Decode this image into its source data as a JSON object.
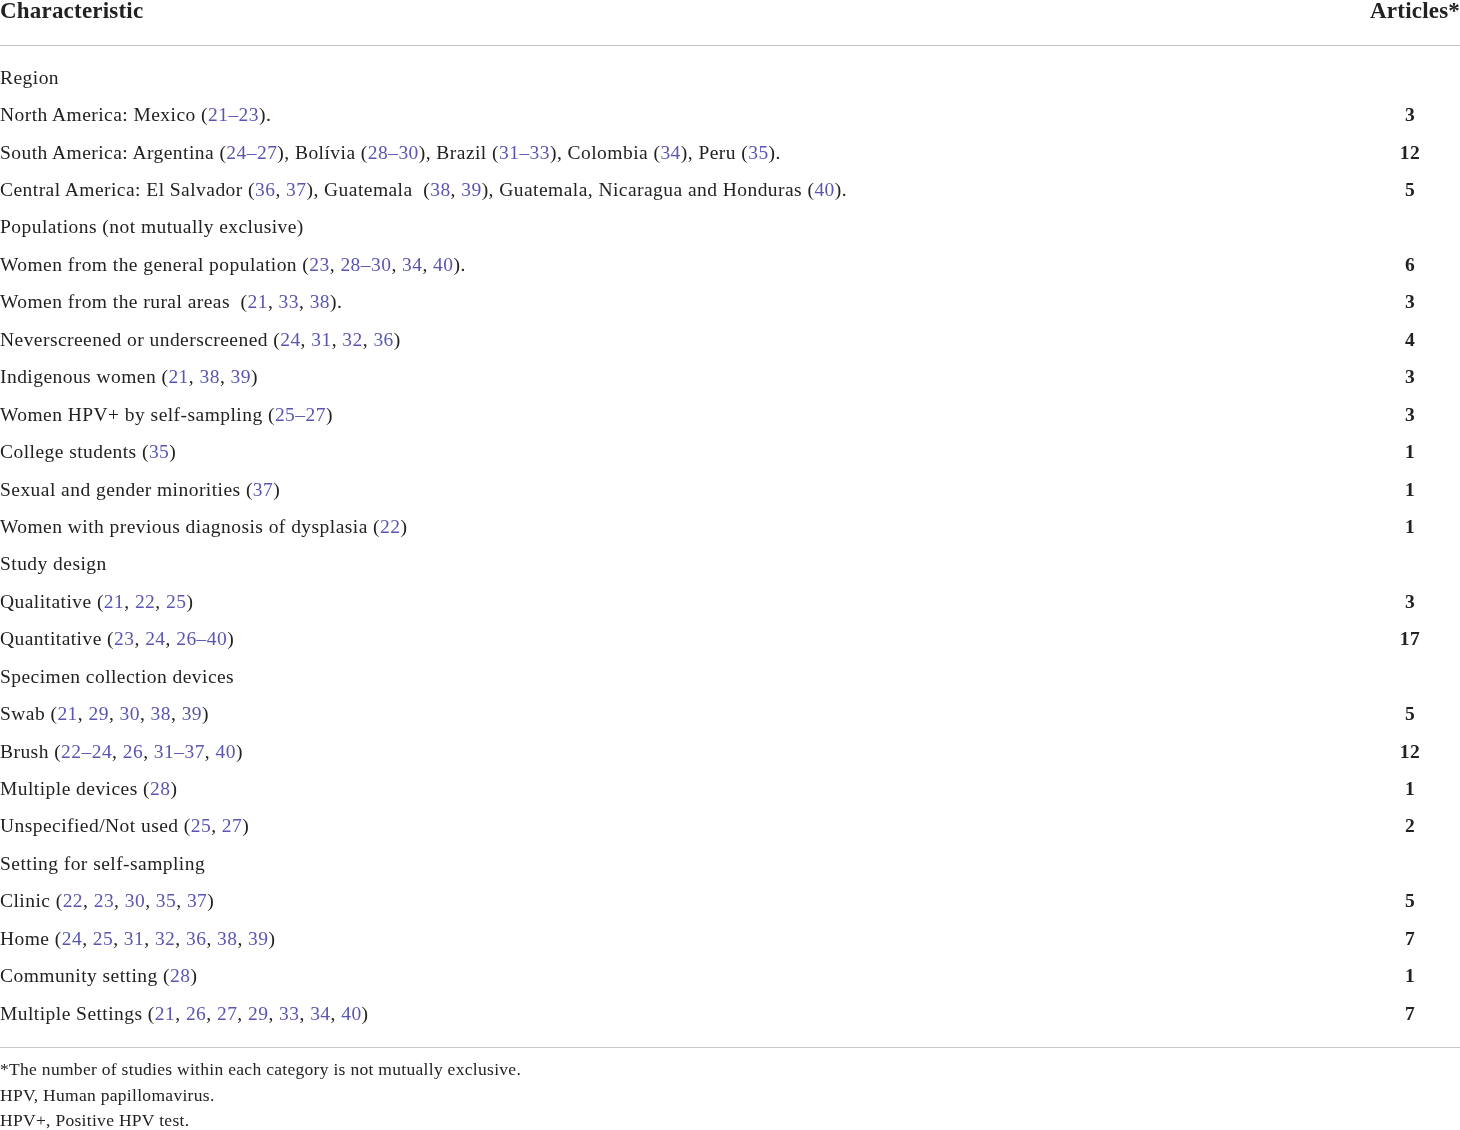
{
  "table": {
    "columns": [
      "Characteristic",
      "Articles*"
    ],
    "rows": [
      {
        "kind": "group",
        "segments": [
          {
            "kind": "text",
            "text": "Region"
          }
        ]
      },
      {
        "kind": "item",
        "count": "3",
        "segments": [
          {
            "kind": "text",
            "text": "North America: Mexico ("
          },
          {
            "kind": "citation",
            "text": "21–23"
          },
          {
            "kind": "text",
            "text": ")."
          }
        ]
      },
      {
        "kind": "item",
        "count": "12",
        "segments": [
          {
            "kind": "text",
            "text": "South America: Argentina ("
          },
          {
            "kind": "citation",
            "text": "24–27"
          },
          {
            "kind": "text",
            "text": "), Bolívia ("
          },
          {
            "kind": "citation",
            "text": "28–30"
          },
          {
            "kind": "text",
            "text": "), Brazil ("
          },
          {
            "kind": "citation",
            "text": "31–33"
          },
          {
            "kind": "text",
            "text": "), Colombia ("
          },
          {
            "kind": "citation",
            "text": "34"
          },
          {
            "kind": "text",
            "text": "), Peru ("
          },
          {
            "kind": "citation",
            "text": "35"
          },
          {
            "kind": "text",
            "text": ")."
          }
        ]
      },
      {
        "kind": "item",
        "count": "5",
        "segments": [
          {
            "kind": "text",
            "text": "Central America: El Salvador ("
          },
          {
            "kind": "citation",
            "text": "36"
          },
          {
            "kind": "text",
            "text": ", "
          },
          {
            "kind": "citation",
            "text": "37"
          },
          {
            "kind": "text",
            "text": "), Guatemala  ("
          },
          {
            "kind": "citation",
            "text": "38"
          },
          {
            "kind": "text",
            "text": ", "
          },
          {
            "kind": "citation",
            "text": "39"
          },
          {
            "kind": "text",
            "text": "), Guatemala, Nicaragua and Honduras ("
          },
          {
            "kind": "citation",
            "text": "40"
          },
          {
            "kind": "text",
            "text": ")."
          }
        ]
      },
      {
        "kind": "group",
        "segments": [
          {
            "kind": "text",
            "text": "Populations (not mutually exclusive)"
          }
        ]
      },
      {
        "kind": "item",
        "count": "6",
        "segments": [
          {
            "kind": "text",
            "text": "Women from the general population ("
          },
          {
            "kind": "citation",
            "text": "23"
          },
          {
            "kind": "text",
            "text": ", "
          },
          {
            "kind": "citation",
            "text": "28–30"
          },
          {
            "kind": "text",
            "text": ", "
          },
          {
            "kind": "citation",
            "text": "34"
          },
          {
            "kind": "text",
            "text": ", "
          },
          {
            "kind": "citation",
            "text": "40"
          },
          {
            "kind": "text",
            "text": ")."
          }
        ]
      },
      {
        "kind": "item",
        "count": "3",
        "segments": [
          {
            "kind": "text",
            "text": "Women from the rural areas  ("
          },
          {
            "kind": "citation",
            "text": "21"
          },
          {
            "kind": "text",
            "text": ", "
          },
          {
            "kind": "citation",
            "text": "33"
          },
          {
            "kind": "text",
            "text": ", "
          },
          {
            "kind": "citation",
            "text": "38"
          },
          {
            "kind": "text",
            "text": ")."
          }
        ]
      },
      {
        "kind": "item",
        "count": "4",
        "segments": [
          {
            "kind": "text",
            "text": "Neverscreened or underscreened ("
          },
          {
            "kind": "citation",
            "text": "24"
          },
          {
            "kind": "text",
            "text": ", "
          },
          {
            "kind": "citation",
            "text": "31"
          },
          {
            "kind": "text",
            "text": ", "
          },
          {
            "kind": "citation",
            "text": "32"
          },
          {
            "kind": "text",
            "text": ", "
          },
          {
            "kind": "citation",
            "text": "36"
          },
          {
            "kind": "text",
            "text": ")"
          }
        ]
      },
      {
        "kind": "item",
        "count": "3",
        "segments": [
          {
            "kind": "text",
            "text": "Indigenous women ("
          },
          {
            "kind": "citation",
            "text": "21"
          },
          {
            "kind": "text",
            "text": ", "
          },
          {
            "kind": "citation",
            "text": "38"
          },
          {
            "kind": "text",
            "text": ", "
          },
          {
            "kind": "citation",
            "text": "39"
          },
          {
            "kind": "text",
            "text": ")"
          }
        ]
      },
      {
        "kind": "item",
        "count": "3",
        "segments": [
          {
            "kind": "text",
            "text": "Women HPV+ by self-sampling ("
          },
          {
            "kind": "citation",
            "text": "25–27"
          },
          {
            "kind": "text",
            "text": ")"
          }
        ]
      },
      {
        "kind": "item",
        "count": "1",
        "segments": [
          {
            "kind": "text",
            "text": "College students ("
          },
          {
            "kind": "citation",
            "text": "35"
          },
          {
            "kind": "text",
            "text": ")"
          }
        ]
      },
      {
        "kind": "item",
        "count": "1",
        "segments": [
          {
            "kind": "text",
            "text": "Sexual and gender minorities ("
          },
          {
            "kind": "citation",
            "text": "37"
          },
          {
            "kind": "text",
            "text": ")"
          }
        ]
      },
      {
        "kind": "item",
        "count": "1",
        "segments": [
          {
            "kind": "text",
            "text": "Women with previous diagnosis of dysplasia ("
          },
          {
            "kind": "citation",
            "text": "22"
          },
          {
            "kind": "text",
            "text": ")"
          }
        ]
      },
      {
        "kind": "group",
        "segments": [
          {
            "kind": "text",
            "text": "Study design"
          }
        ]
      },
      {
        "kind": "item",
        "count": "3",
        "segments": [
          {
            "kind": "text",
            "text": "Qualitative ("
          },
          {
            "kind": "citation",
            "text": "21"
          },
          {
            "kind": "text",
            "text": ", "
          },
          {
            "kind": "citation",
            "text": "22"
          },
          {
            "kind": "text",
            "text": ", "
          },
          {
            "kind": "citation",
            "text": "25"
          },
          {
            "kind": "text",
            "text": ")"
          }
        ]
      },
      {
        "kind": "item",
        "count": "17",
        "segments": [
          {
            "kind": "text",
            "text": "Quantitative ("
          },
          {
            "kind": "citation",
            "text": "23"
          },
          {
            "kind": "text",
            "text": ", "
          },
          {
            "kind": "citation",
            "text": "24"
          },
          {
            "kind": "text",
            "text": ", "
          },
          {
            "kind": "citation",
            "text": "26–40"
          },
          {
            "kind": "text",
            "text": ")"
          }
        ]
      },
      {
        "kind": "group",
        "segments": [
          {
            "kind": "text",
            "text": "Specimen collection devices"
          }
        ]
      },
      {
        "kind": "item",
        "count": "5",
        "segments": [
          {
            "kind": "text",
            "text": "Swab ("
          },
          {
            "kind": "citation",
            "text": "21"
          },
          {
            "kind": "text",
            "text": ", "
          },
          {
            "kind": "citation",
            "text": "29"
          },
          {
            "kind": "text",
            "text": ", "
          },
          {
            "kind": "citation",
            "text": "30"
          },
          {
            "kind": "text",
            "text": ", "
          },
          {
            "kind": "citation",
            "text": "38"
          },
          {
            "kind": "text",
            "text": ", "
          },
          {
            "kind": "citation",
            "text": "39"
          },
          {
            "kind": "text",
            "text": ")"
          }
        ]
      },
      {
        "kind": "item",
        "count": "12",
        "segments": [
          {
            "kind": "text",
            "text": "Brush ("
          },
          {
            "kind": "citation",
            "text": "22–24"
          },
          {
            "kind": "text",
            "text": ", "
          },
          {
            "kind": "citation",
            "text": "26"
          },
          {
            "kind": "text",
            "text": ", "
          },
          {
            "kind": "citation",
            "text": "31–37"
          },
          {
            "kind": "text",
            "text": ", "
          },
          {
            "kind": "citation",
            "text": "40"
          },
          {
            "kind": "text",
            "text": ")"
          }
        ]
      },
      {
        "kind": "item",
        "count": "1",
        "segments": [
          {
            "kind": "text",
            "text": "Multiple devices ("
          },
          {
            "kind": "citation",
            "text": "28"
          },
          {
            "kind": "text",
            "text": ")"
          }
        ]
      },
      {
        "kind": "item",
        "count": "2",
        "segments": [
          {
            "kind": "text",
            "text": "Unspecified/Not used ("
          },
          {
            "kind": "citation",
            "text": "25"
          },
          {
            "kind": "text",
            "text": ", "
          },
          {
            "kind": "citation",
            "text": "27"
          },
          {
            "kind": "text",
            "text": ")"
          }
        ]
      },
      {
        "kind": "group",
        "segments": [
          {
            "kind": "text",
            "text": "Setting for self-sampling"
          }
        ]
      },
      {
        "kind": "item",
        "count": "5",
        "segments": [
          {
            "kind": "text",
            "text": "Clinic ("
          },
          {
            "kind": "citation",
            "text": "22"
          },
          {
            "kind": "text",
            "text": ", "
          },
          {
            "kind": "citation",
            "text": "23"
          },
          {
            "kind": "text",
            "text": ", "
          },
          {
            "kind": "citation",
            "text": "30"
          },
          {
            "kind": "text",
            "text": ", "
          },
          {
            "kind": "citation",
            "text": "35"
          },
          {
            "kind": "text",
            "text": ", "
          },
          {
            "kind": "citation",
            "text": "37"
          },
          {
            "kind": "text",
            "text": ")"
          }
        ]
      },
      {
        "kind": "item",
        "count": "7",
        "segments": [
          {
            "kind": "text",
            "text": "Home ("
          },
          {
            "kind": "citation",
            "text": "24"
          },
          {
            "kind": "text",
            "text": ", "
          },
          {
            "kind": "citation",
            "text": "25"
          },
          {
            "kind": "text",
            "text": ", "
          },
          {
            "kind": "citation",
            "text": "31"
          },
          {
            "kind": "text",
            "text": ", "
          },
          {
            "kind": "citation",
            "text": "32"
          },
          {
            "kind": "text",
            "text": ", "
          },
          {
            "kind": "citation",
            "text": "36"
          },
          {
            "kind": "text",
            "text": ", "
          },
          {
            "kind": "citation",
            "text": "38"
          },
          {
            "kind": "text",
            "text": ", "
          },
          {
            "kind": "citation",
            "text": "39"
          },
          {
            "kind": "text",
            "text": ")"
          }
        ]
      },
      {
        "kind": "item",
        "count": "1",
        "segments": [
          {
            "kind": "text",
            "text": "Community setting ("
          },
          {
            "kind": "citation",
            "text": "28"
          },
          {
            "kind": "text",
            "text": ")"
          }
        ]
      },
      {
        "kind": "item",
        "count": "7",
        "segments": [
          {
            "kind": "text",
            "text": "Multiple Settings ("
          },
          {
            "kind": "citation",
            "text": "21"
          },
          {
            "kind": "text",
            "text": ", "
          },
          {
            "kind": "citation",
            "text": "26"
          },
          {
            "kind": "text",
            "text": ", "
          },
          {
            "kind": "citation",
            "text": "27"
          },
          {
            "kind": "text",
            "text": ", "
          },
          {
            "kind": "citation",
            "text": "29"
          },
          {
            "kind": "text",
            "text": ", "
          },
          {
            "kind": "citation",
            "text": "33"
          },
          {
            "kind": "text",
            "text": ", "
          },
          {
            "kind": "citation",
            "text": "34"
          },
          {
            "kind": "text",
            "text": ", "
          },
          {
            "kind": "citation",
            "text": "40"
          },
          {
            "kind": "text",
            "text": ")"
          }
        ]
      }
    ]
  },
  "footnotes": [
    "*The number of studies within each category is not mutually exclusive.",
    "HPV, Human papillomavirus.",
    "HPV+, Positive HPV test."
  ]
}
